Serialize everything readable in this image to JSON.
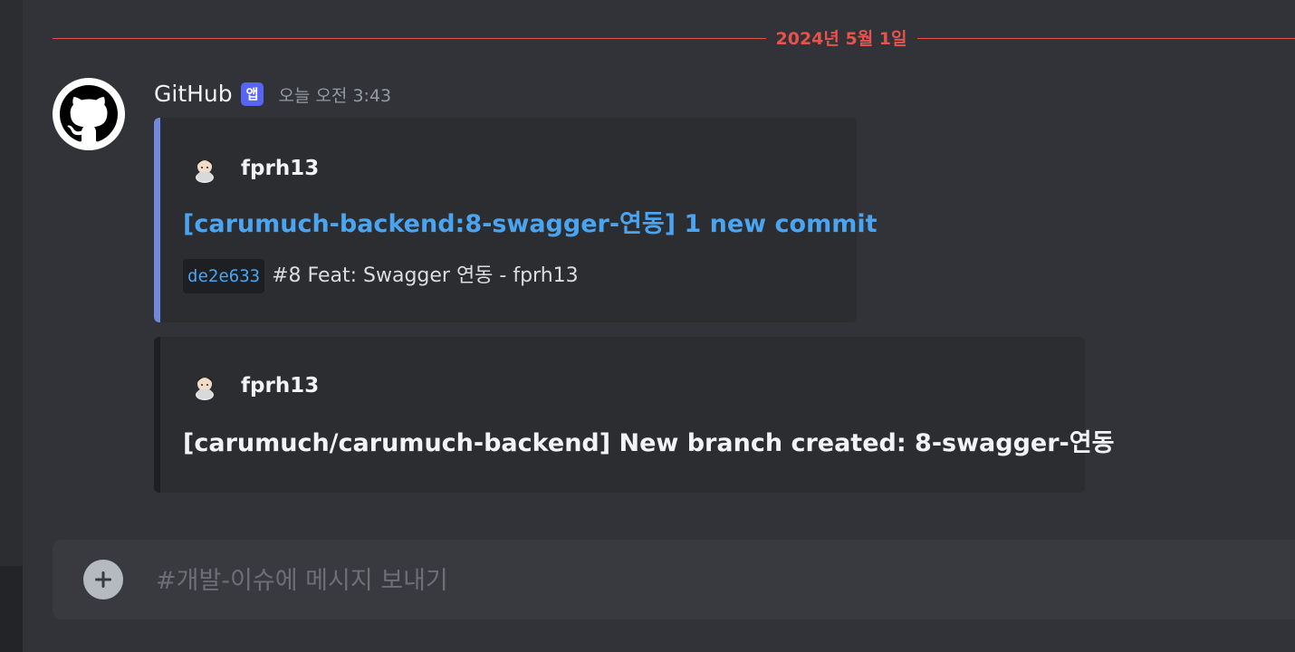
{
  "date_divider": {
    "text": "2024년 5월 1일"
  },
  "message": {
    "author": "GitHub",
    "app_badge": "앱",
    "timestamp": "오늘 오전 3:43",
    "embeds": [
      {
        "author_name": "fprh13",
        "title": "[carumuch-backend:8-swagger-연동] 1 new commit",
        "commit_hash": "de2e633",
        "commit_message": "#8 Feat: Swagger 연동 - fprh13",
        "accent_color": "#7289da"
      },
      {
        "author_name": "fprh13",
        "title": "[carumuch/carumuch-backend] New branch created: 8-swagger-연동",
        "accent_color": "#1e1f22"
      }
    ]
  },
  "composer": {
    "placeholder": "#개발-이슈에 메시지 보내기"
  },
  "icons": {
    "avatar": "github-octocat-icon",
    "embed_author": "user-avatar-icon",
    "add": "plus-circle-icon"
  },
  "colors": {
    "background": "#313338",
    "embed_background": "#2b2d31",
    "link": "#4aa4f0",
    "date_divider": "#e5534b",
    "badge": "#5865f2"
  }
}
